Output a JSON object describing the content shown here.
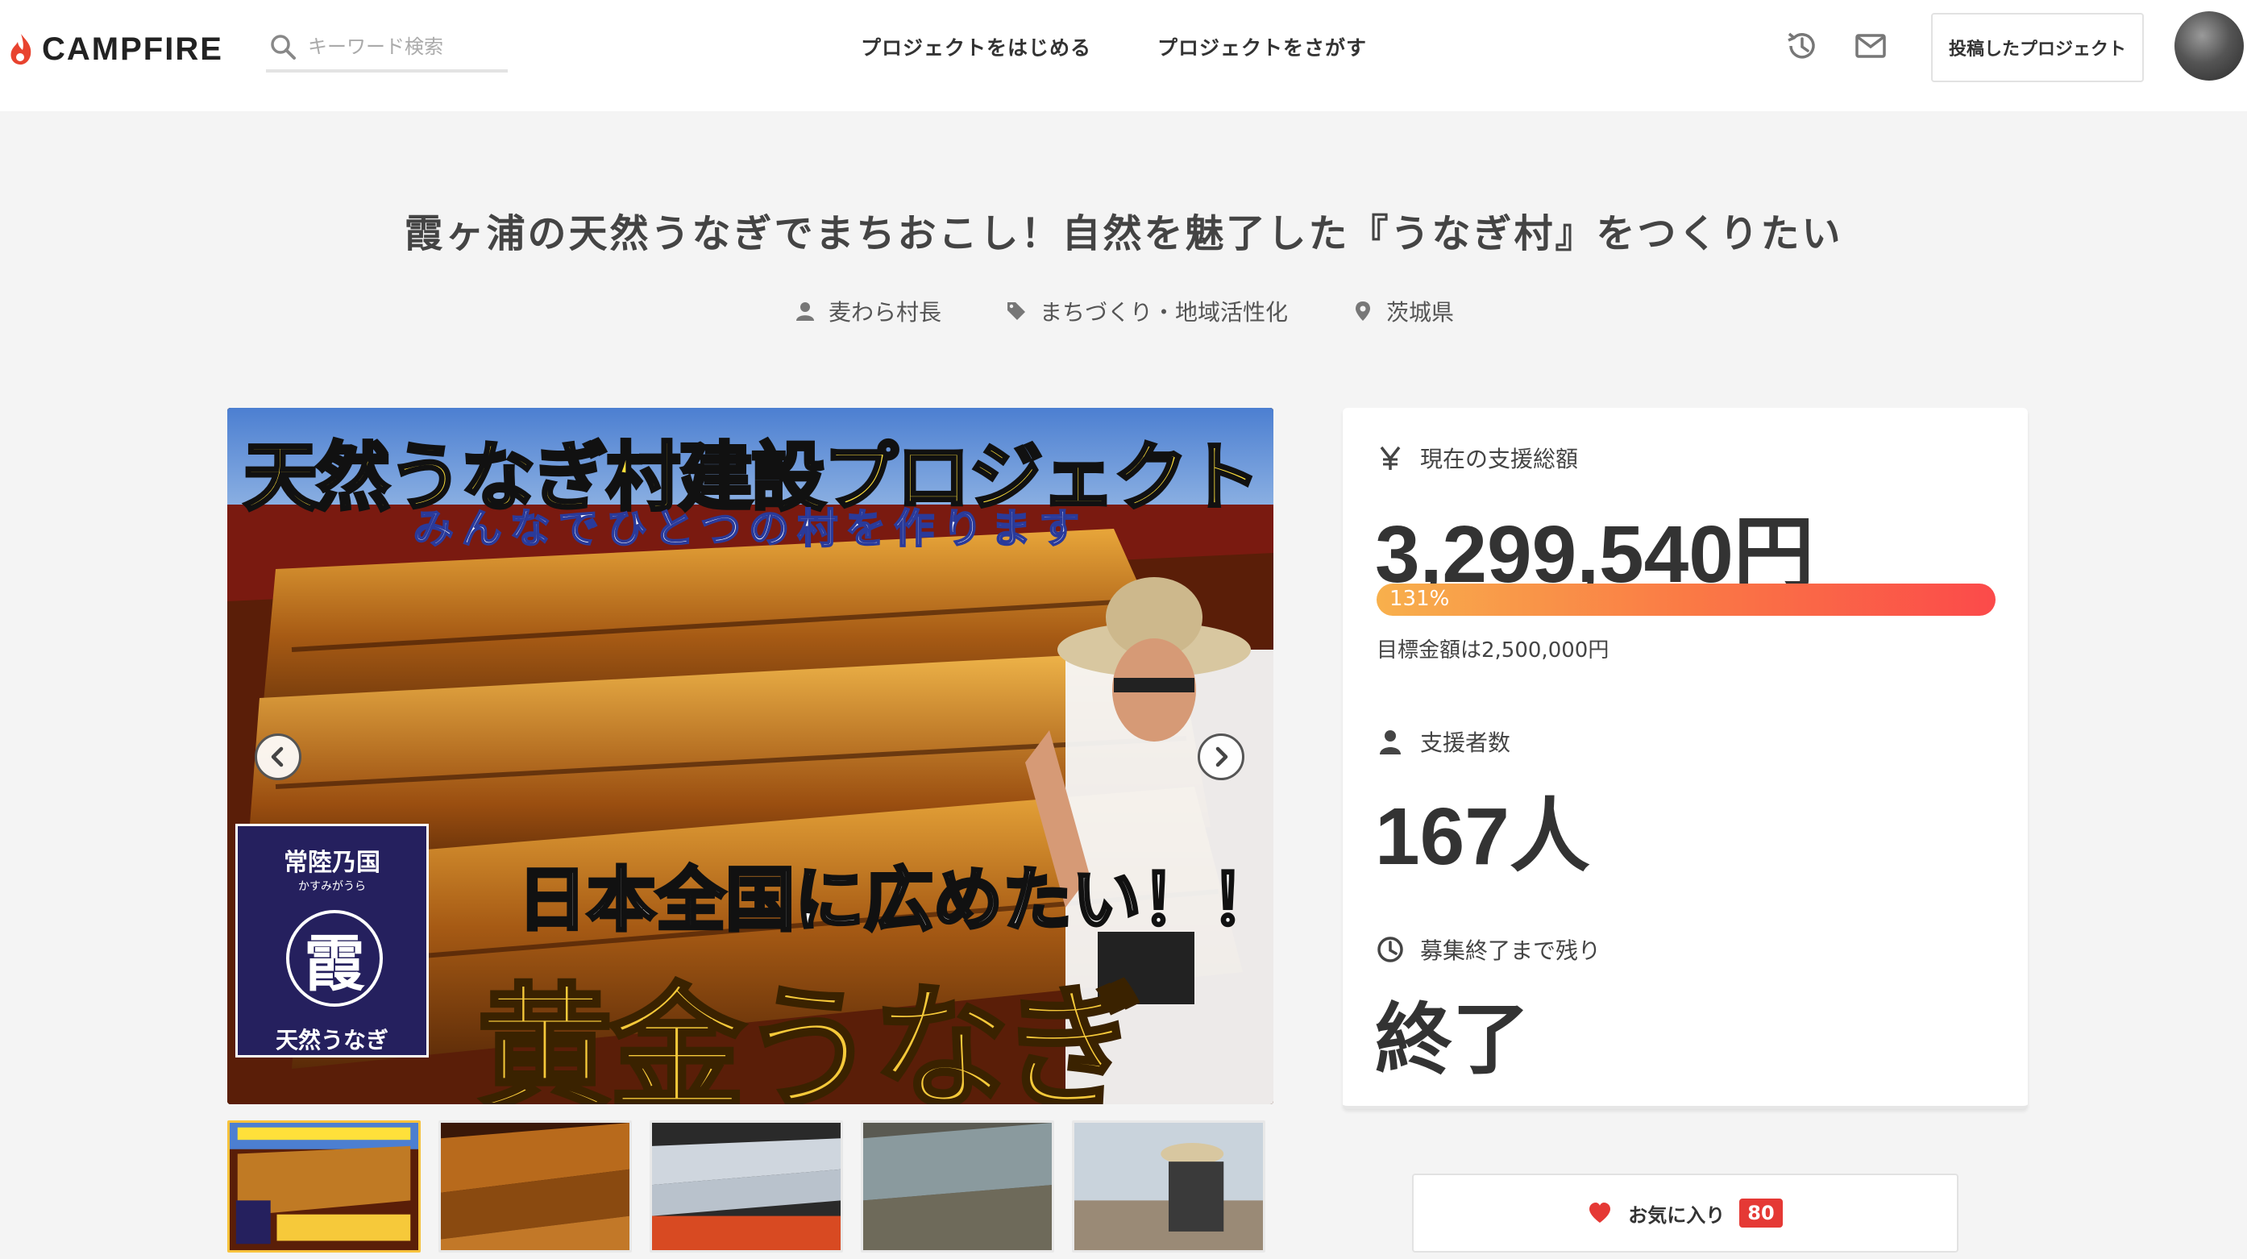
{
  "header": {
    "logo_text": "CAMPFIRE",
    "search_placeholder": "キーワード検索",
    "nav": [
      "プロジェクトをはじめる",
      "プロジェクトをさがす"
    ],
    "my_projects_label": "投稿したプロジェクト"
  },
  "project": {
    "title": "霞ヶ浦の天然うなぎでまちおこし！自然を魅了した『うなぎ村』をつくりたい",
    "owner": "麦わら村長",
    "category": "まちづくり・地域活性化",
    "location": "茨城県"
  },
  "main_image": {
    "headline": "天然うなぎ村建設プロジェクト",
    "subheadline": "みんなでひとつの村を作ります",
    "spread_text": "日本全国に広めたい！！",
    "gold_text": "黄金うなぎ",
    "badge_title": "常陸乃国",
    "badge_kana": "かすみがうら",
    "badge_kanji": "霞",
    "badge_bottom": "天然うなぎ"
  },
  "thumbnails": [
    {
      "name": "thumb-1",
      "active": true
    },
    {
      "name": "thumb-2",
      "active": false
    },
    {
      "name": "thumb-3",
      "active": false
    },
    {
      "name": "thumb-4",
      "active": false
    },
    {
      "name": "thumb-5",
      "active": false
    }
  ],
  "stats": {
    "funding_label": "現在の支援総額",
    "funding_amount": "3,299,540円",
    "percent": "131%",
    "percent_value": 1.31,
    "goal_text": "目標金額は2,500,000円",
    "backers_label": "支援者数",
    "backers_count": "167人",
    "remaining_label": "募集終了まで残り",
    "remaining_value": "終了"
  },
  "favorite": {
    "label": "お気に入り",
    "count": "80"
  },
  "colors": {
    "brand_red": "#e8432f",
    "progress_start": "#f8b04c",
    "progress_end": "#fb4a4a",
    "fav_heart": "#e53935"
  },
  "icons": [
    "campfire-logo-icon",
    "search-icon",
    "history-icon",
    "mail-icon",
    "user-icon",
    "tag-icon",
    "location-pin-icon",
    "yen-icon",
    "clock-icon",
    "heart-icon",
    "chevron-left-icon",
    "chevron-right-icon"
  ]
}
